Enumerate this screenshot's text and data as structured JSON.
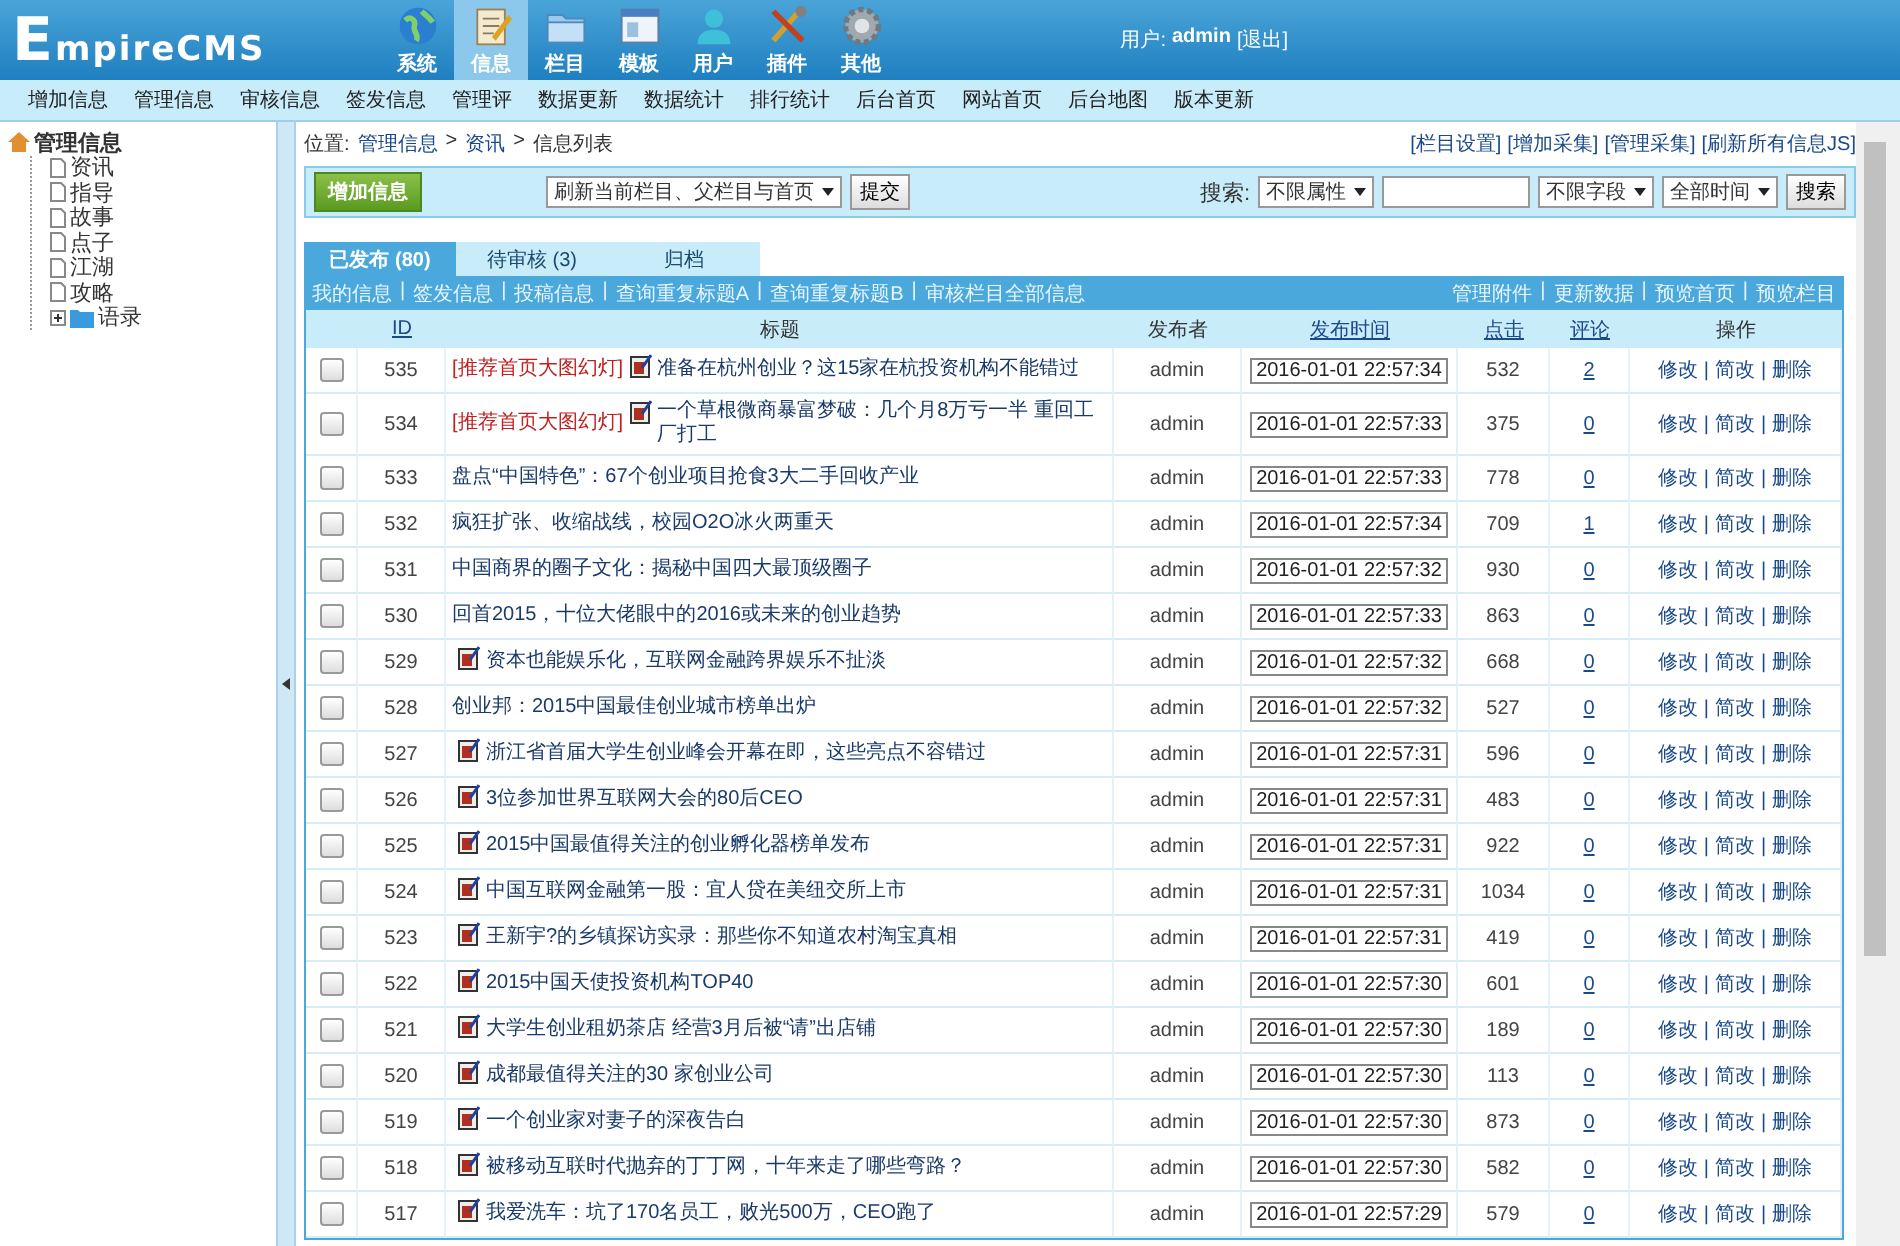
{
  "header": {
    "logo": "EmpireCMS",
    "nav": [
      {
        "label": "系统",
        "selected": false
      },
      {
        "label": "信息",
        "selected": true
      },
      {
        "label": "栏目",
        "selected": false
      },
      {
        "label": "模板",
        "selected": false
      },
      {
        "label": "用户",
        "selected": false
      },
      {
        "label": "插件",
        "selected": false
      },
      {
        "label": "其他",
        "selected": false
      }
    ],
    "user_label": "用户:",
    "user_name": "admin",
    "logout": "[退出]"
  },
  "submenu": [
    "增加信息",
    "管理信息",
    "审核信息",
    "签发信息",
    "管理评",
    "数据更新",
    "数据统计",
    "排行统计",
    "后台首页",
    "网站首页",
    "后台地图",
    "版本更新"
  ],
  "sidebar": {
    "tree": [
      {
        "label": "管理信息",
        "kind": "root",
        "expanded": true,
        "children": [
          {
            "label": "资讯",
            "kind": "page"
          },
          {
            "label": "指导",
            "kind": "page"
          },
          {
            "label": "故事",
            "kind": "page"
          },
          {
            "label": "点子",
            "kind": "page"
          },
          {
            "label": "江湖",
            "kind": "page"
          },
          {
            "label": "攻略",
            "kind": "page"
          },
          {
            "label": "语录",
            "kind": "folder",
            "expanded": false
          }
        ]
      }
    ]
  },
  "breadcrumb": {
    "label": "位置:",
    "path": [
      "管理信息",
      "资讯",
      "信息列表"
    ],
    "separator": ">"
  },
  "top_links": [
    "[栏目设置]",
    "[增加采集]",
    "[管理采集]",
    "[刷新所有信息JS]"
  ],
  "toolbar": {
    "add_button": "增加信息",
    "refresh_select": "刷新当前栏目、父栏目与首页",
    "submit_button": "提交",
    "search_label": "搜索:",
    "attr_select": "不限属性",
    "field_select": "不限字段",
    "time_select": "全部时间",
    "search_button": "搜索"
  },
  "tabs": [
    {
      "label": "已发布 (80)",
      "selected": true
    },
    {
      "label": "待审核 (3)",
      "selected": false
    },
    {
      "label": "归档",
      "selected": false
    }
  ],
  "left_links": [
    "我的信息",
    "签发信息",
    "投稿信息",
    "查询重复标题A",
    "查询重复标题B",
    "审核栏目全部信息"
  ],
  "right_links": [
    "管理附件",
    "更新数据",
    "预览首页",
    "预览栏目"
  ],
  "link_separator": "|",
  "table": {
    "action_separator": "|",
    "columns": [
      {
        "label": "ID",
        "sortable": true
      },
      {
        "label": "标题",
        "sortable": false
      },
      {
        "label": "发布者",
        "sortable": false
      },
      {
        "label": "发布时间",
        "sortable": true
      },
      {
        "label": "点击",
        "sortable": true
      },
      {
        "label": "评论",
        "sortable": true
      },
      {
        "label": "操作",
        "sortable": false
      }
    ],
    "rows": [
      {
        "checked": false,
        "id": "535",
        "tag": "[推荐首页大图幻灯]",
        "has_icon": true,
        "title": "准备在杭州创业？这15家在杭投资机构不能错过",
        "publisher": "admin",
        "time": "2016-01-01 22:57:34",
        "clicks": "532",
        "comments": "2",
        "actions": [
          "修改",
          "简改",
          "删除"
        ]
      },
      {
        "checked": false,
        "id": "534",
        "tag": "[推荐首页大图幻灯]",
        "has_icon": true,
        "title": "一个草根微商暴富梦破：几个月8万亏一半 重回工厂打工",
        "publisher": "admin",
        "time": "2016-01-01 22:57:33",
        "clicks": "375",
        "comments": "0",
        "actions": [
          "修改",
          "简改",
          "删除"
        ]
      },
      {
        "checked": false,
        "id": "533",
        "has_icon": false,
        "title": "盘点“中国特色”：67个创业项目抢食3大二手回收产业",
        "publisher": "admin",
        "time": "2016-01-01 22:57:33",
        "clicks": "778",
        "comments": "0",
        "actions": [
          "修改",
          "简改",
          "删除"
        ]
      },
      {
        "checked": false,
        "id": "532",
        "has_icon": false,
        "title": "疯狂扩张、收缩战线，校园O2O冰火两重天",
        "publisher": "admin",
        "time": "2016-01-01 22:57:34",
        "clicks": "709",
        "comments": "1",
        "actions": [
          "修改",
          "简改",
          "删除"
        ]
      },
      {
        "checked": false,
        "id": "531",
        "has_icon": false,
        "title": "中国商界的圈子文化：揭秘中国四大最顶级圈子",
        "publisher": "admin",
        "time": "2016-01-01 22:57:32",
        "clicks": "930",
        "comments": "0",
        "actions": [
          "修改",
          "简改",
          "删除"
        ]
      },
      {
        "checked": false,
        "id": "530",
        "has_icon": false,
        "title": "回首2015，十位大佬眼中的2016或未来的创业趋势",
        "publisher": "admin",
        "time": "2016-01-01 22:57:33",
        "clicks": "863",
        "comments": "0",
        "actions": [
          "修改",
          "简改",
          "删除"
        ]
      },
      {
        "checked": false,
        "id": "529",
        "has_icon": true,
        "title": "资本也能娱乐化，互联网金融跨界娱乐不扯淡",
        "publisher": "admin",
        "time": "2016-01-01 22:57:32",
        "clicks": "668",
        "comments": "0",
        "actions": [
          "修改",
          "简改",
          "删除"
        ]
      },
      {
        "checked": false,
        "id": "528",
        "has_icon": false,
        "title": "创业邦：2015中国最佳创业城市榜单出炉",
        "publisher": "admin",
        "time": "2016-01-01 22:57:32",
        "clicks": "527",
        "comments": "0",
        "actions": [
          "修改",
          "简改",
          "删除"
        ]
      },
      {
        "checked": false,
        "id": "527",
        "has_icon": true,
        "title": "浙江省首届大学生创业峰会开幕在即，这些亮点不容错过",
        "publisher": "admin",
        "time": "2016-01-01 22:57:31",
        "clicks": "596",
        "comments": "0",
        "actions": [
          "修改",
          "简改",
          "删除"
        ]
      },
      {
        "checked": false,
        "id": "526",
        "has_icon": true,
        "title": "3位参加世界互联网大会的80后CEO",
        "publisher": "admin",
        "time": "2016-01-01 22:57:31",
        "clicks": "483",
        "comments": "0",
        "actions": [
          "修改",
          "简改",
          "删除"
        ]
      },
      {
        "checked": false,
        "id": "525",
        "has_icon": true,
        "title": "2015中国最值得关注的创业孵化器榜单发布",
        "publisher": "admin",
        "time": "2016-01-01 22:57:31",
        "clicks": "922",
        "comments": "0",
        "actions": [
          "修改",
          "简改",
          "删除"
        ]
      },
      {
        "checked": false,
        "id": "524",
        "has_icon": true,
        "title": "中国互联网金融第一股：宜人贷在美纽交所上市",
        "publisher": "admin",
        "time": "2016-01-01 22:57:31",
        "clicks": "1034",
        "comments": "0",
        "actions": [
          "修改",
          "简改",
          "删除"
        ]
      },
      {
        "checked": false,
        "id": "523",
        "has_icon": true,
        "title": "王新宇?的乡镇探访实录：那些你不知道农村淘宝真相",
        "publisher": "admin",
        "time": "2016-01-01 22:57:31",
        "clicks": "419",
        "comments": "0",
        "actions": [
          "修改",
          "简改",
          "删除"
        ]
      },
      {
        "checked": false,
        "id": "522",
        "has_icon": true,
        "title": "2015中国天使投资机构TOP40",
        "publisher": "admin",
        "time": "2016-01-01 22:57:30",
        "clicks": "601",
        "comments": "0",
        "actions": [
          "修改",
          "简改",
          "删除"
        ]
      },
      {
        "checked": false,
        "id": "521",
        "has_icon": true,
        "title": "大学生创业租奶茶店 经营3月后被“请”出店铺",
        "publisher": "admin",
        "time": "2016-01-01 22:57:30",
        "clicks": "189",
        "comments": "0",
        "actions": [
          "修改",
          "简改",
          "删除"
        ]
      },
      {
        "checked": false,
        "id": "520",
        "has_icon": true,
        "title": "成都最值得关注的30 家创业公司",
        "publisher": "admin",
        "time": "2016-01-01 22:57:30",
        "clicks": "113",
        "comments": "0",
        "actions": [
          "修改",
          "简改",
          "删除"
        ]
      },
      {
        "checked": false,
        "id": "519",
        "has_icon": true,
        "title": "一个创业家对妻子的深夜告白",
        "publisher": "admin",
        "time": "2016-01-01 22:57:30",
        "clicks": "873",
        "comments": "0",
        "actions": [
          "修改",
          "简改",
          "删除"
        ]
      },
      {
        "checked": false,
        "id": "518",
        "has_icon": true,
        "title": "被移动互联时代抛弃的丁丁网，十年来走了哪些弯路？",
        "publisher": "admin",
        "time": "2016-01-01 22:57:30",
        "clicks": "582",
        "comments": "0",
        "actions": [
          "修改",
          "简改",
          "删除"
        ]
      },
      {
        "checked": false,
        "id": "517",
        "has_icon": true,
        "title": "我爱洗车：坑了170名员工，败光500万，CEO跑了",
        "publisher": "admin",
        "time": "2016-01-01 22:57:29",
        "clicks": "579",
        "comments": "0",
        "actions": [
          "修改",
          "简改",
          "删除"
        ]
      }
    ]
  }
}
